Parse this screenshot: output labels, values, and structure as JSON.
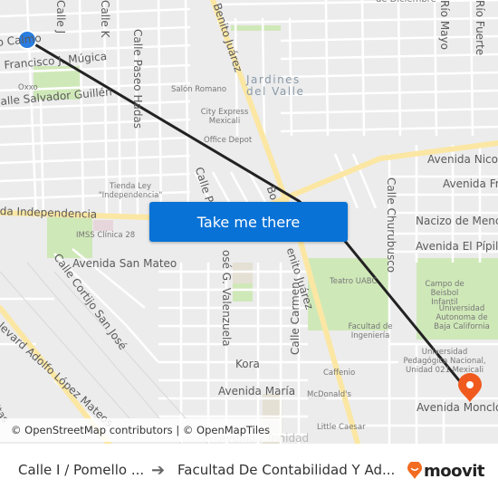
{
  "colors": {
    "map_background": "#ececec",
    "street": "#ffffff",
    "major_road": "#fbe7a3",
    "park": "#cfe8b8",
    "route_line": "#222222",
    "origin_marker": "#2a7de1",
    "destination_marker": "#f05a1e",
    "button": "#0872d6",
    "moovit_brand": "#f26b21"
  },
  "map": {
    "streets": [
      {
        "name": "Calle J",
        "kind": "street"
      },
      {
        "name": "Calle K",
        "kind": "street"
      },
      {
        "name": "Calle Pomello / Calle Calmo",
        "display": "o Calmo",
        "kind": "street"
      },
      {
        "name": "Francisco J. Múgica",
        "kind": "street"
      },
      {
        "name": "Calle Salvador Guillén",
        "display": "alle Salvador Guillén",
        "kind": "street"
      },
      {
        "name": "Calle Paseo Hadas",
        "kind": "street"
      },
      {
        "name": "Benito Juárez",
        "kind": "street"
      },
      {
        "name": "de Diciembre",
        "kind": "street"
      },
      {
        "name": "Río Mayo",
        "kind": "street"
      },
      {
        "name": "Río Fuerte",
        "kind": "street"
      },
      {
        "name": "Avenida Independencia",
        "display": "da Independencia",
        "kind": "street"
      },
      {
        "name": "Calle P",
        "kind": "street"
      },
      {
        "name": "Boulevard Benito Juárez",
        "display": "Bo",
        "kind": "street"
      },
      {
        "name": "Avenida Nico",
        "kind": "street"
      },
      {
        "name": "Avenida Fr",
        "kind": "street"
      },
      {
        "name": "Calle Churubusco",
        "kind": "street"
      },
      {
        "name": "Nacizo de Menc",
        "kind": "street"
      },
      {
        "name": "Avenida El Pípila",
        "kind": "street"
      },
      {
        "name": "Avenida San Mateo",
        "kind": "street"
      },
      {
        "name": "Calle Cortijo San José",
        "kind": "street"
      },
      {
        "name": "José G. Valenzuela",
        "display": "osé G. Valenzuela",
        "kind": "street"
      },
      {
        "name": "Calle Carmen",
        "kind": "street"
      },
      {
        "name": "Benito Juárez",
        "display": "enito Juárez",
        "kind": "street"
      },
      {
        "name": "Bulevard Adolfo López Mateos",
        "display": "levard Adolfo López Mateos",
        "kind": "street"
      },
      {
        "name": "Kora",
        "kind": "street"
      },
      {
        "name": "Avenida María",
        "kind": "street"
      },
      {
        "name": "Avenida Trinidad",
        "display": "Avenida Trinidad",
        "kind": "street"
      },
      {
        "name": "Avenida Moncl",
        "display": "Avenida Monclo",
        "kind": "street"
      },
      {
        "name": "itas",
        "kind": "street"
      }
    ],
    "pois": [
      {
        "name": "Oxxo"
      },
      {
        "name": "Salón Romano"
      },
      {
        "name": "City Express Mexicali"
      },
      {
        "name": "Office Depot"
      },
      {
        "name": "Tienda Ley \"Independencia\""
      },
      {
        "name": "IMSS Clínica 28"
      },
      {
        "name": "Teatro UABC"
      },
      {
        "name": "Campo de Beisbol Infantil"
      },
      {
        "name": "Universidad Autonoma de Baja California"
      },
      {
        "name": "Facultad de Ingeniería"
      },
      {
        "name": "Universidad Pedagógica Nacional, Unidad 021 Mexicali"
      },
      {
        "name": "Caffenio"
      },
      {
        "name": "McDonald's"
      },
      {
        "name": "Little Caesar"
      }
    ],
    "areas": [
      {
        "name": "Jardines del Valle",
        "line1": "Jardines",
        "line2": "del Valle"
      }
    ],
    "origin_marker": {
      "icon": "origin-dot-icon"
    },
    "destination_marker": {
      "icon": "map-pin-icon"
    }
  },
  "button": {
    "label": "Take me there"
  },
  "attribution": {
    "osm": "© OpenStreetMap contributors",
    "separator": "|",
    "omt": "© OpenMapTiles"
  },
  "footer": {
    "origin": "Calle I / Pomello ...",
    "arrow_icon": "arrow-right-icon",
    "destination": "Facultad De Contabilidad Y Ad...",
    "brand": "moovit"
  }
}
